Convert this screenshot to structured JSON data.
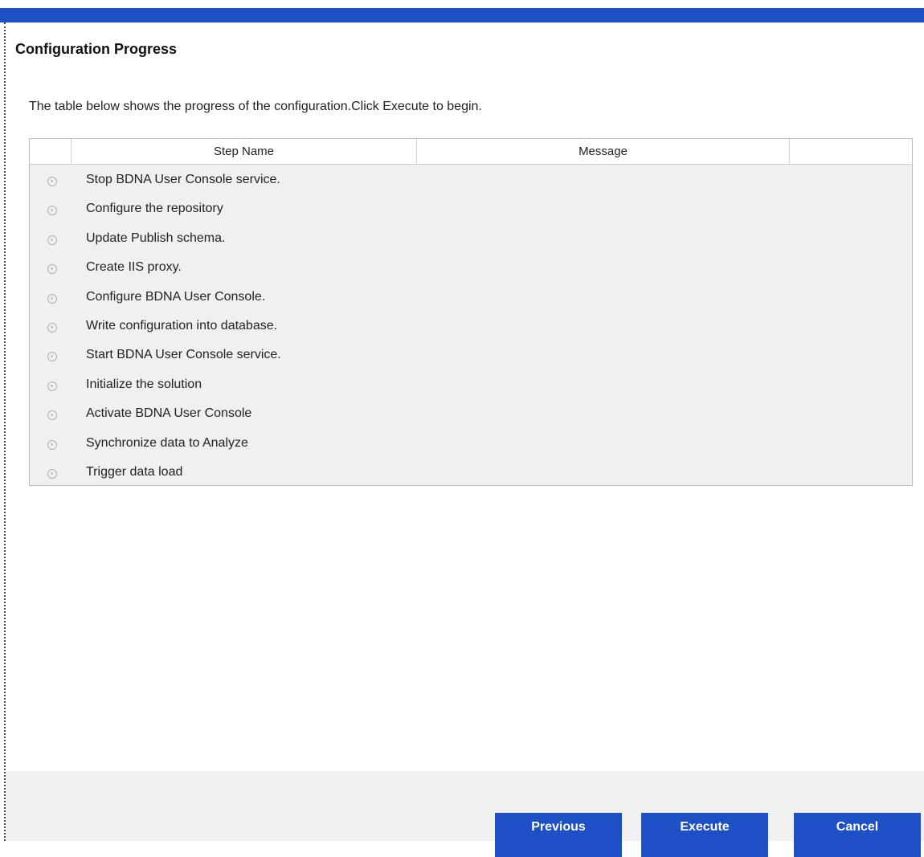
{
  "header": {
    "title": "Configuration Progress",
    "description": "The table below shows the progress of the configuration.Click Execute to begin."
  },
  "table": {
    "columns": [
      "",
      "Step Name",
      "Message",
      ""
    ],
    "rows": [
      {
        "status_icon": "pending-status-icon",
        "name": "Stop BDNA User Console service.",
        "message": ""
      },
      {
        "status_icon": "pending-status-icon",
        "name": "Configure the repository",
        "message": ""
      },
      {
        "status_icon": "pending-status-icon",
        "name": "Update Publish schema.",
        "message": ""
      },
      {
        "status_icon": "pending-status-icon",
        "name": "Create IIS proxy.",
        "message": ""
      },
      {
        "status_icon": "pending-status-icon",
        "name": "Configure BDNA User Console.",
        "message": ""
      },
      {
        "status_icon": "pending-status-icon",
        "name": "Write configuration into database.",
        "message": ""
      },
      {
        "status_icon": "pending-status-icon",
        "name": "Start BDNA User Console service.",
        "message": ""
      },
      {
        "status_icon": "pending-status-icon",
        "name": "Initialize the solution",
        "message": ""
      },
      {
        "status_icon": "pending-status-icon",
        "name": "Activate BDNA User Console",
        "message": ""
      },
      {
        "status_icon": "pending-status-icon",
        "name": "Synchronize data to Analyze",
        "message": ""
      },
      {
        "status_icon": "pending-status-icon",
        "name": "Trigger data load",
        "message": ""
      }
    ]
  },
  "buttons": {
    "previous": "Previous",
    "execute": "Execute",
    "cancel": "Cancel"
  },
  "colors": {
    "accent": "#1f4fc4",
    "grid_background": "#f0f0f0",
    "footer_background": "#f0f0f0"
  }
}
